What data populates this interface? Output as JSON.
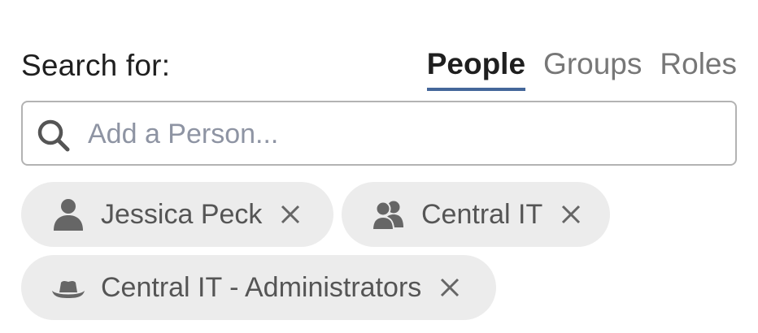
{
  "header": {
    "label": "Search for:"
  },
  "tabs": [
    {
      "label": "People",
      "active": true
    },
    {
      "label": "Groups",
      "active": false
    },
    {
      "label": "Roles",
      "active": false
    }
  ],
  "search": {
    "placeholder": "Add a Person...",
    "value": "",
    "icon": "search-icon"
  },
  "chips": [
    {
      "label": "Jessica Peck",
      "icon": "person-icon"
    },
    {
      "label": "Central IT",
      "icon": "group-icon"
    },
    {
      "label": "Central IT - Administrators",
      "icon": "role-hat-icon"
    }
  ],
  "colors": {
    "active_tab_underline": "#44679a",
    "chip_background": "#ececec",
    "chip_text": "#555555",
    "placeholder": "#8e94a3"
  }
}
